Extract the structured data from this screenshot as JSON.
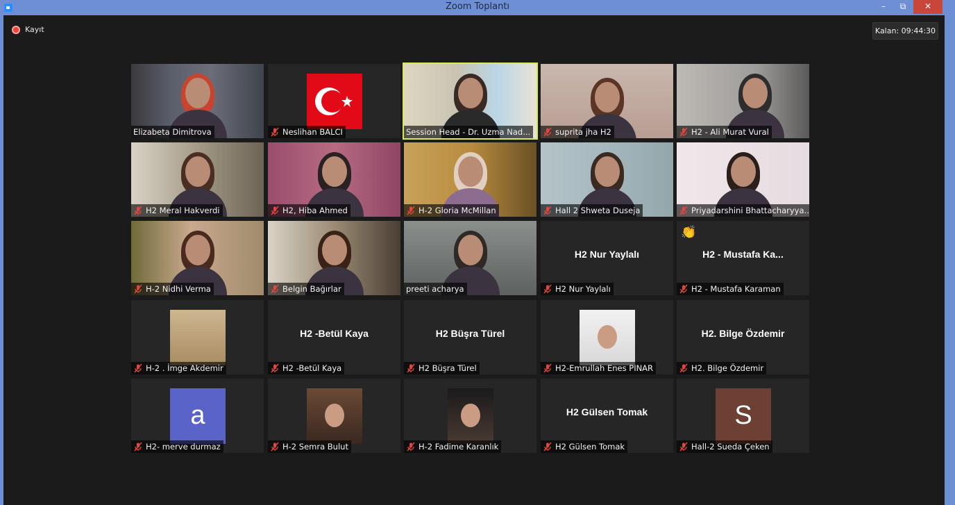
{
  "window": {
    "title": "Zoom Toplantı",
    "minimize": "–",
    "restore": "⧉",
    "close": "✕"
  },
  "recording": {
    "label": "Kayıt"
  },
  "timer": {
    "text": "Kalan: 09:44:30"
  },
  "tiles": [
    {
      "name": "Elizabeta Dimitrova",
      "muted": false
    },
    {
      "name": "Neslihan BALCI",
      "muted": true
    },
    {
      "name": "Session Head - Dr. Uzma Nad...",
      "muted": false,
      "active": true
    },
    {
      "name": "suprita jha H2",
      "muted": true
    },
    {
      "name": "H2 - Ali Murat Vural",
      "muted": true
    },
    {
      "name": "H2 Meral Hakverdi",
      "muted": true
    },
    {
      "name": "H2, Hiba Ahmed",
      "muted": true
    },
    {
      "name": "H-2 Gloria McMillan",
      "muted": true
    },
    {
      "name": "Hall 2 Shweta Duseja",
      "muted": true
    },
    {
      "name": "Priyadarshini Bhattacharyya...",
      "muted": true
    },
    {
      "name": "H-2 Nidhi Verma",
      "muted": true
    },
    {
      "name": "Belgin Bağırlar",
      "muted": true
    },
    {
      "name": "preeti acharya",
      "muted": false
    },
    {
      "name": "H2 Nur Yaylalı",
      "muted": true,
      "center": "H2 Nur Yaylalı"
    },
    {
      "name": "H2 - Mustafa Karaman",
      "muted": true,
      "center": "H2 - Mustafa Ka..."
    },
    {
      "name": "H-2 . İmge Akdemir",
      "muted": true
    },
    {
      "name": "H2 -Betül Kaya",
      "muted": true,
      "center": "H2 -Betül Kaya"
    },
    {
      "name": "H2 Büşra Türel",
      "muted": true,
      "center": "H2 Büşra Türel"
    },
    {
      "name": "H2-Emrullah Enes PINAR",
      "muted": true
    },
    {
      "name": "H2. Bilge Özdemir",
      "muted": true,
      "center": "H2. Bilge Özdemir"
    },
    {
      "name": "H2- merve durmaz",
      "muted": true,
      "avatar": "a"
    },
    {
      "name": "H-2 Semra Bulut",
      "muted": true
    },
    {
      "name": "H-2 Fadime Karanlık",
      "muted": true
    },
    {
      "name": "H2 Gülsen Tomak",
      "muted": true,
      "center": "H2 Gülsen Tomak"
    },
    {
      "name": "Hall-2 Sueda Çeken",
      "muted": true,
      "avatar": "S"
    }
  ],
  "colors": {
    "active_border": "#d8ea56",
    "avatar_a": "#5a64c8",
    "avatar_s": "#6e3f33",
    "recording": "#e8463c"
  },
  "icons": {
    "mute": "microphone-muted-icon",
    "reaction": "clapping-hands-icon"
  }
}
